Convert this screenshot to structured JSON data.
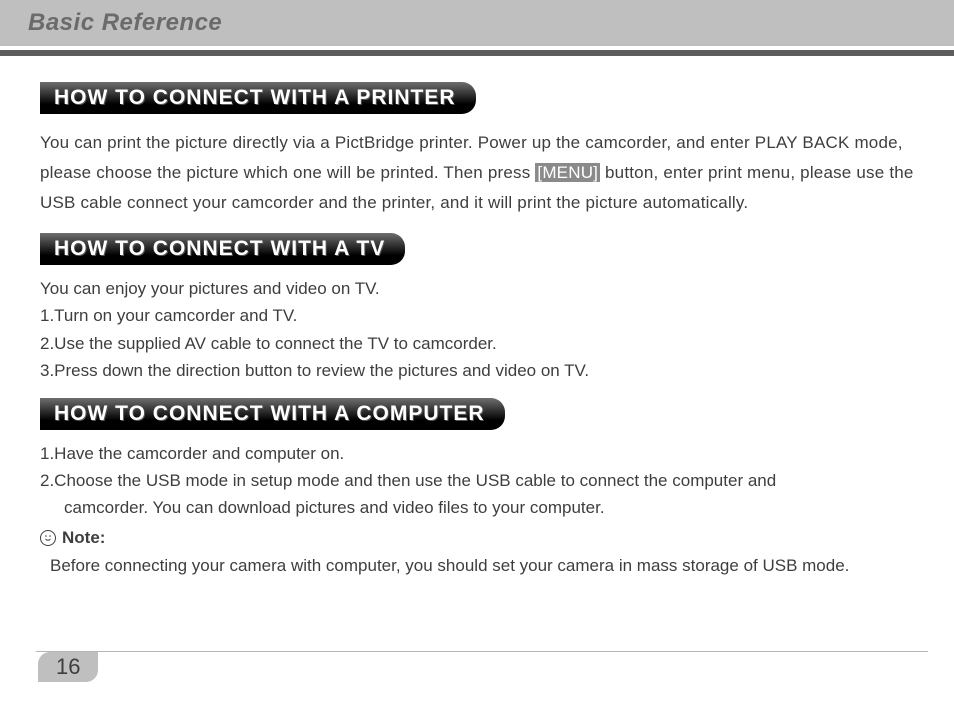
{
  "header": {
    "title": "Basic Reference"
  },
  "sections": {
    "printer": {
      "heading": "HOW TO CONNECT WITH A PRINTER",
      "para_before": "You can print the picture directly via a PictBridge printer. Power up the camcorder, and enter PLAY BACK mode, please choose the picture which one will be printed. Then press ",
      "menu_label": "[MENU]",
      "para_after": " button, enter print menu, please use the USB cable connect your camcorder and the printer, and it will print the picture automatically."
    },
    "tv": {
      "heading": "HOW TO CONNECT WITH A TV",
      "intro": "You can enjoy your pictures and video on TV.",
      "steps": [
        "1.Turn on your camcorder and TV.",
        "2.Use the supplied AV cable to connect the TV to camcorder.",
        "3.Press down the direction button to review the pictures and video on TV."
      ]
    },
    "computer": {
      "heading": "HOW TO CONNECT WITH A COMPUTER",
      "steps": [
        "1.Have the camcorder and computer on.",
        "2.Choose the USB mode in setup mode and then use the USB cable to connect the computer and",
        "camcorder. You can download pictures and video files to your computer."
      ],
      "note_label": "Note:",
      "note_text": "Before connecting your camera with computer, you should set your camera in mass storage of USB mode."
    }
  },
  "page_number": "16"
}
